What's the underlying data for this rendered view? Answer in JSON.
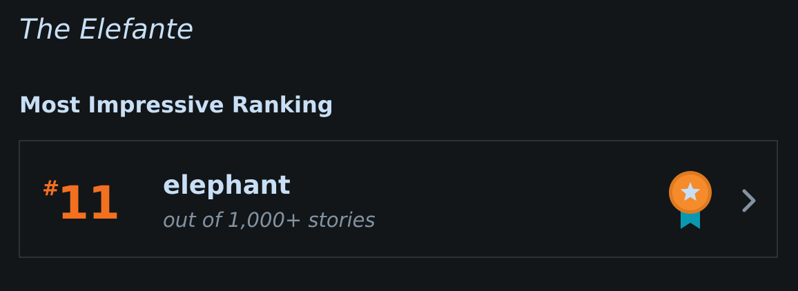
{
  "story": {
    "title": "The Elefante"
  },
  "ranking_section": {
    "heading": "Most Impressive Ranking",
    "card": {
      "rank_symbol": "#",
      "rank_number": "11",
      "tag": "elephant",
      "subtitle": "out of 1,000+ stories"
    }
  },
  "colors": {
    "background": "#121619",
    "heading_text": "#c8dff5",
    "rank_accent": "#f37021",
    "subtitle_text": "#8393a1",
    "medal_ribbon": "#0a98b0",
    "medal_star": "#c8dff5",
    "chevron": "#8393a1"
  },
  "icons": {
    "medal": "medal-star-icon",
    "chevron": "chevron-right-icon"
  }
}
